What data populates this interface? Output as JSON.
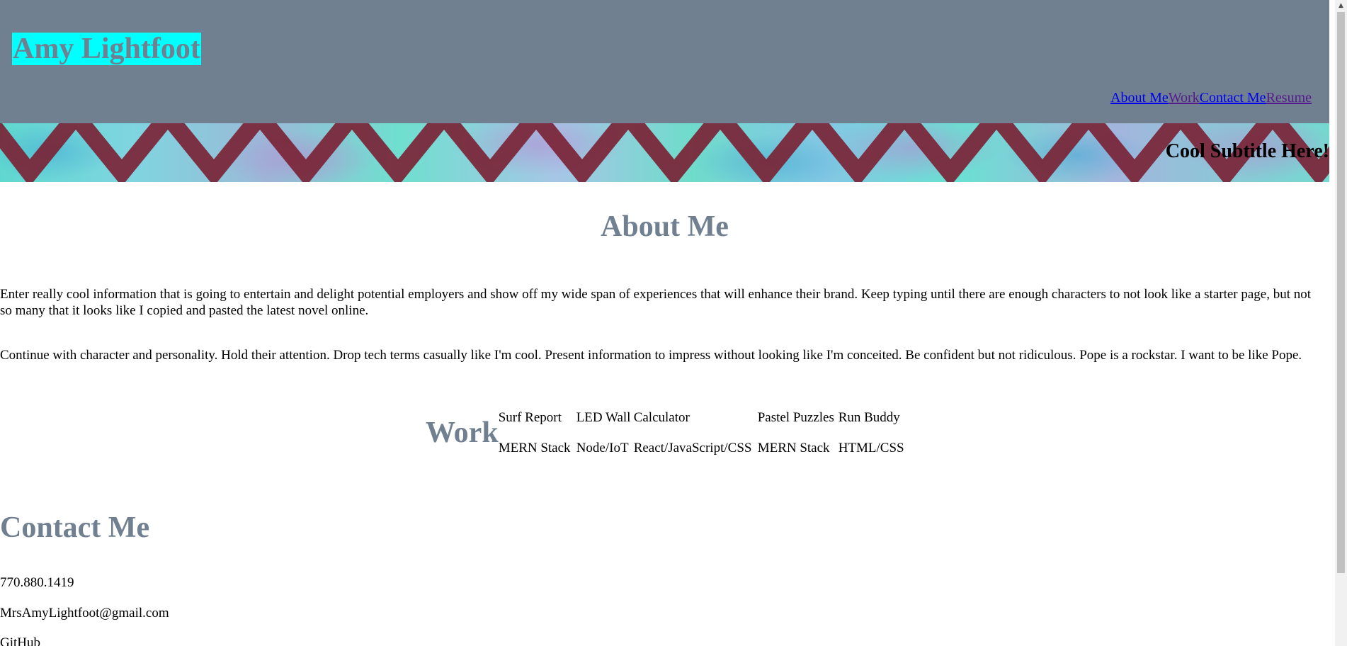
{
  "header": {
    "title": "Amy Lightfoot",
    "nav": [
      {
        "label": "About Me",
        "state": "unvisited"
      },
      {
        "label": "Work",
        "state": "visited"
      },
      {
        "label": "Contact Me",
        "state": "unvisited"
      },
      {
        "label": "Resume",
        "state": "visited"
      }
    ]
  },
  "banner": {
    "subtitle": "Cool Subtitle Here!"
  },
  "about": {
    "heading": "About Me",
    "paragraphs": [
      "Enter really cool information that is going to entertain and delight potential employers and show off my wide span of experiences that will enhance their brand. Keep typing until there are enough characters to not look like a starter page, but not so many that it looks like I copied and pasted the latest novel online.",
      "Continue with character and personality. Hold their attention. Drop tech terms casually like I'm cool. Present information to impress without looking like I'm conceited. Be confident but not ridiculous. Pope is a rockstar. I want to be like Pope."
    ]
  },
  "work": {
    "heading": "Work",
    "projects": [
      {
        "name": "Surf Report",
        "tech": "MERN Stack"
      },
      {
        "name": "LED Wall",
        "tech": "Node/IoT"
      },
      {
        "name": "Calculator",
        "tech": "React/JavaScript/CSS"
      },
      {
        "name": "Pastel Puzzles",
        "tech": "MERN Stack"
      },
      {
        "name": "Run Buddy",
        "tech": "HTML/CSS"
      }
    ]
  },
  "contact": {
    "heading": "Contact Me",
    "phone": "770.880.1419",
    "email": "MrsAmyLightfoot@gmail.com",
    "github": "GitHub"
  },
  "colors": {
    "header_background": "#708090",
    "title_highlight": "#00ffff",
    "heading_text": "#708090",
    "link": "#0000ee",
    "visited_link": "#551a8b",
    "banner_chevron": "#7a2436"
  }
}
